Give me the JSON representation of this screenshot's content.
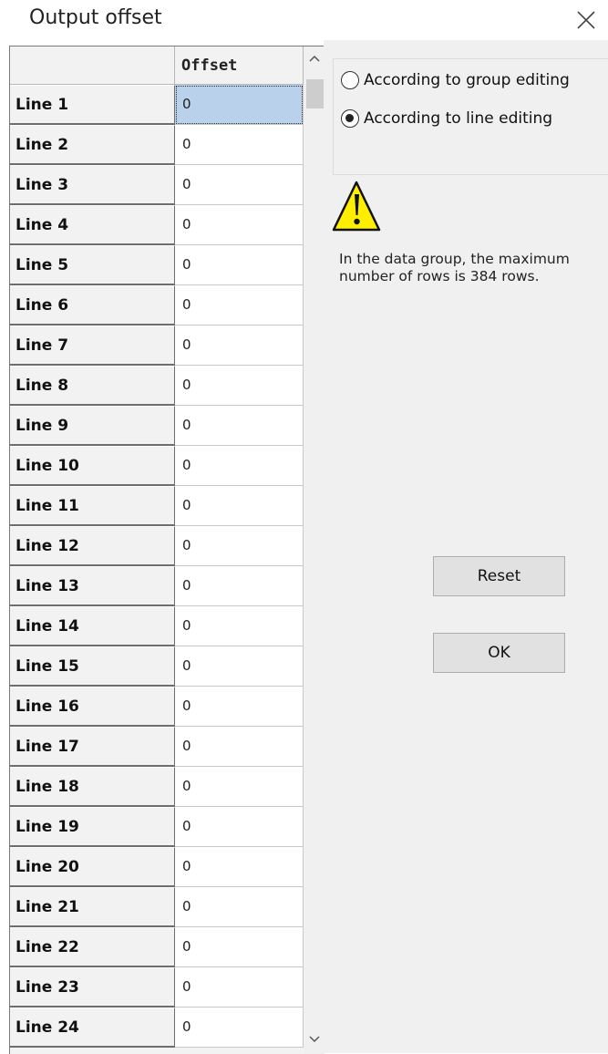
{
  "dialog": {
    "title": "Output offset"
  },
  "grid": {
    "column_header": "Offset",
    "rows": [
      {
        "label": "Line 1",
        "value": "0"
      },
      {
        "label": "Line 2",
        "value": "0"
      },
      {
        "label": "Line 3",
        "value": "0"
      },
      {
        "label": "Line 4",
        "value": "0"
      },
      {
        "label": "Line 5",
        "value": "0"
      },
      {
        "label": "Line 6",
        "value": "0"
      },
      {
        "label": "Line 7",
        "value": "0"
      },
      {
        "label": "Line 8",
        "value": "0"
      },
      {
        "label": "Line 9",
        "value": "0"
      },
      {
        "label": "Line 10",
        "value": "0"
      },
      {
        "label": "Line 11",
        "value": "0"
      },
      {
        "label": "Line 12",
        "value": "0"
      },
      {
        "label": "Line 13",
        "value": "0"
      },
      {
        "label": "Line 14",
        "value": "0"
      },
      {
        "label": "Line 15",
        "value": "0"
      },
      {
        "label": "Line 16",
        "value": "0"
      },
      {
        "label": "Line 17",
        "value": "0"
      },
      {
        "label": "Line 18",
        "value": "0"
      },
      {
        "label": "Line 19",
        "value": "0"
      },
      {
        "label": "Line 20",
        "value": "0"
      },
      {
        "label": "Line 21",
        "value": "0"
      },
      {
        "label": "Line 22",
        "value": "0"
      },
      {
        "label": "Line 23",
        "value": "0"
      },
      {
        "label": "Line 24",
        "value": "0"
      }
    ]
  },
  "edit_mode": {
    "options": [
      {
        "label": "According to group editing",
        "selected": false
      },
      {
        "label": "According to line editing",
        "selected": true
      }
    ]
  },
  "warning": {
    "icon": "warning-icon",
    "text": "In the data group, the maximum number of rows is 384 rows."
  },
  "buttons": {
    "reset": "Reset",
    "ok": "OK"
  },
  "colors": {
    "selected_cell": "#b9d1ea",
    "warning_yellow": "#ffee00"
  }
}
